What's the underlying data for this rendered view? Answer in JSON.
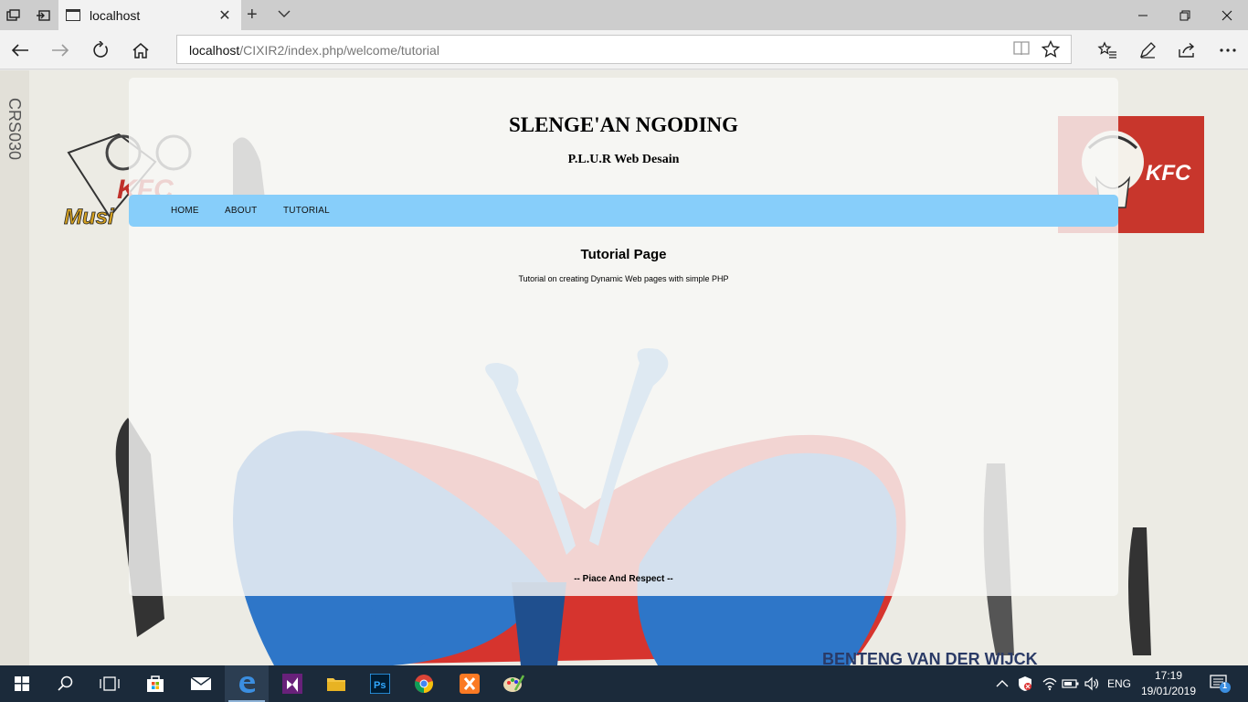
{
  "browser": {
    "tab_title": "localhost",
    "url_host": "localhost",
    "url_path": "/CIXIR2/index.php/welcome/tutorial"
  },
  "page": {
    "site_title": "SLENGE'AN NGODING",
    "site_subtitle": "P.L.U.R Web Desain",
    "menu": [
      {
        "label": "HOME"
      },
      {
        "label": "ABOUT"
      },
      {
        "label": "TUTORIAL"
      }
    ],
    "heading": "Tutorial Page",
    "body_text": "Tutorial on creating Dynamic Web pages with simple PHP",
    "footer": "-- Piace And Respect --",
    "background_text": {
      "side_label": "CRS030",
      "kfc_left": "KFC",
      "music_left": "Musi",
      "kfc_right": "KFC",
      "bottom_text": "BENTENG VAN DER WIJCK"
    },
    "colors": {
      "menu_bg": "#87cefa",
      "container_bg": "#f8f8f6"
    }
  },
  "taskbar": {
    "lang": "ENG",
    "time": "17:19",
    "date": "19/01/2019",
    "notification_count": "1",
    "apps": [
      "windows-start",
      "search",
      "task-view",
      "store",
      "mail",
      "edge",
      "visual-studio",
      "file-explorer",
      "photoshop",
      "chrome",
      "xampp",
      "paint"
    ]
  }
}
